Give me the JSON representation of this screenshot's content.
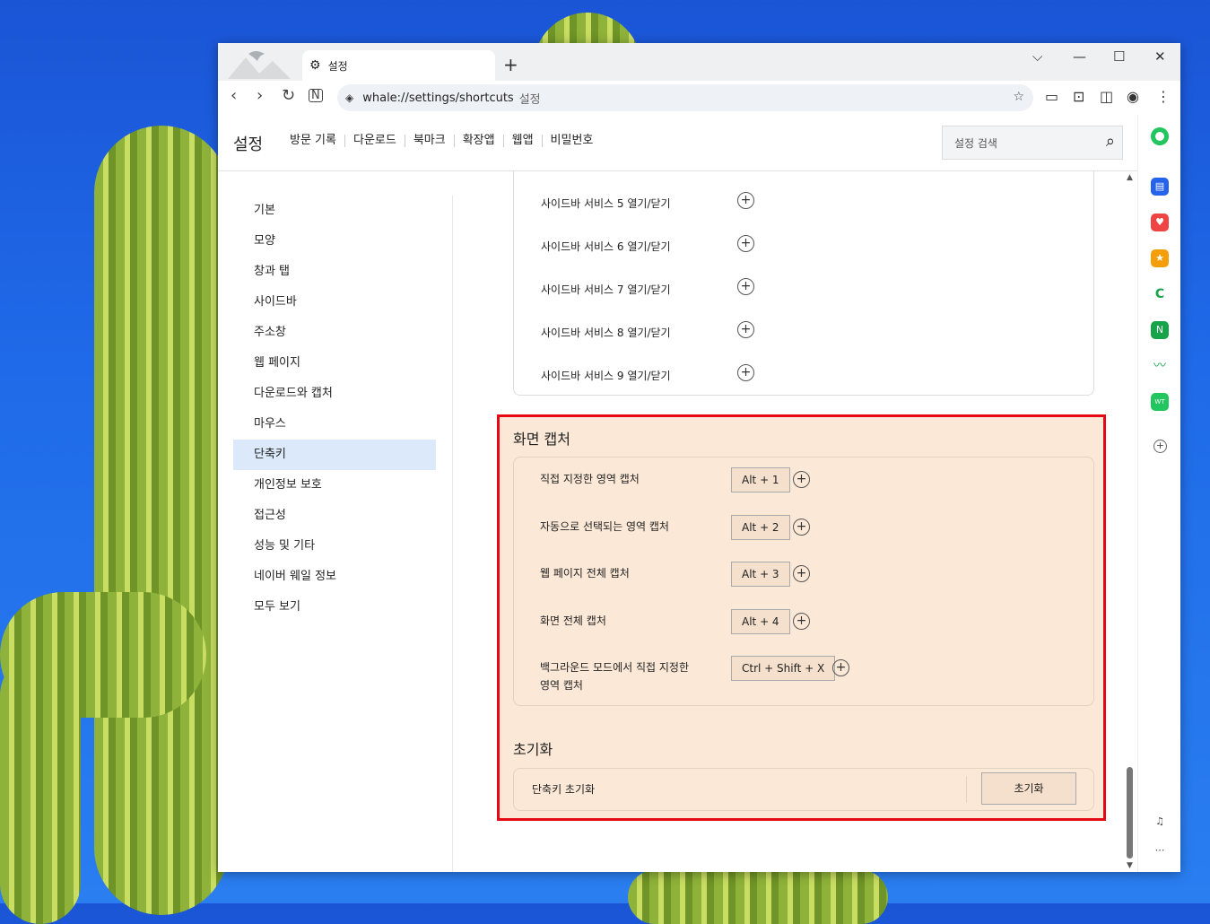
{
  "browser": {
    "tab_title": "설정",
    "new_tab": "+",
    "url": "whale://settings/shortcuts",
    "page_title": "설정"
  },
  "header": {
    "title": "설정",
    "nav": [
      "방문 기록",
      "다운로드",
      "북마크",
      "확장앱",
      "웹앱",
      "비밀번호"
    ],
    "search_placeholder": "설정 검색"
  },
  "sidebar": {
    "items": [
      "기본",
      "모양",
      "창과 탭",
      "사이드바",
      "주소창",
      "웹 페이지",
      "다운로드와 캡처",
      "마우스",
      "단축키",
      "개인정보 보호",
      "접근성",
      "성능 및 기타",
      "네이버 웨일 정보",
      "모두 보기"
    ],
    "active": "단축키"
  },
  "sidebar_services": [
    "사이드바 서비스 5 열기/닫기",
    "사이드바 서비스 6 열기/닫기",
    "사이드바 서비스 7 열기/닫기",
    "사이드바 서비스 8 열기/닫기",
    "사이드바 서비스 9 열기/닫기"
  ],
  "capture": {
    "title": "화면 캡처",
    "rows": [
      {
        "label": "직접 지정한 영역 캡처",
        "key": "Alt + 1"
      },
      {
        "label": "자동으로 선택되는 영역 캡처",
        "key": "Alt + 2"
      },
      {
        "label": "웹 페이지 전체 캡처",
        "key": "Alt + 3"
      },
      {
        "label": "화면 전체 캡처",
        "key": "Alt + 4"
      },
      {
        "label": "백그라운드 모드에서 직접 지정한",
        "label2": "영역 캡처",
        "key": "Ctrl + Shift + X"
      }
    ]
  },
  "reset": {
    "title": "초기화",
    "label": "단축키 초기화",
    "button": "초기화"
  },
  "colors": {
    "highlight_border": "#e50914",
    "highlight_bg": "#fbe8d6",
    "active_nav": "#dbe9fb"
  }
}
